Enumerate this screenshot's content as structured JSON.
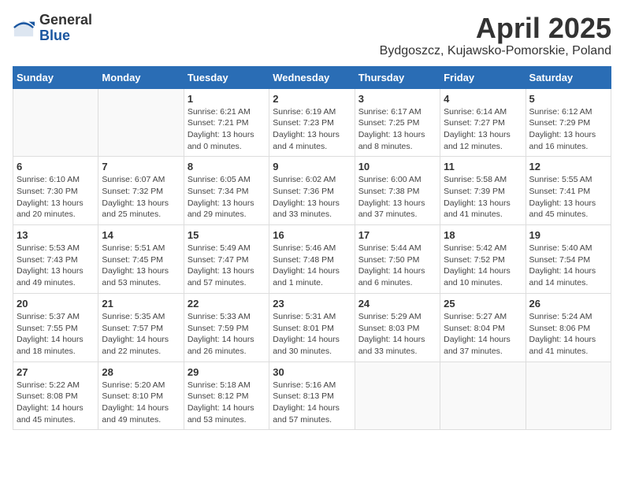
{
  "logo": {
    "general": "General",
    "blue": "Blue"
  },
  "title": "April 2025",
  "subtitle": "Bydgoszcz, Kujawsko-Pomorskie, Poland",
  "headers": [
    "Sunday",
    "Monday",
    "Tuesday",
    "Wednesday",
    "Thursday",
    "Friday",
    "Saturday"
  ],
  "weeks": [
    [
      {
        "day": "",
        "info": ""
      },
      {
        "day": "",
        "info": ""
      },
      {
        "day": "1",
        "info": "Sunrise: 6:21 AM\nSunset: 7:21 PM\nDaylight: 13 hours\nand 0 minutes."
      },
      {
        "day": "2",
        "info": "Sunrise: 6:19 AM\nSunset: 7:23 PM\nDaylight: 13 hours\nand 4 minutes."
      },
      {
        "day": "3",
        "info": "Sunrise: 6:17 AM\nSunset: 7:25 PM\nDaylight: 13 hours\nand 8 minutes."
      },
      {
        "day": "4",
        "info": "Sunrise: 6:14 AM\nSunset: 7:27 PM\nDaylight: 13 hours\nand 12 minutes."
      },
      {
        "day": "5",
        "info": "Sunrise: 6:12 AM\nSunset: 7:29 PM\nDaylight: 13 hours\nand 16 minutes."
      }
    ],
    [
      {
        "day": "6",
        "info": "Sunrise: 6:10 AM\nSunset: 7:30 PM\nDaylight: 13 hours\nand 20 minutes."
      },
      {
        "day": "7",
        "info": "Sunrise: 6:07 AM\nSunset: 7:32 PM\nDaylight: 13 hours\nand 25 minutes."
      },
      {
        "day": "8",
        "info": "Sunrise: 6:05 AM\nSunset: 7:34 PM\nDaylight: 13 hours\nand 29 minutes."
      },
      {
        "day": "9",
        "info": "Sunrise: 6:02 AM\nSunset: 7:36 PM\nDaylight: 13 hours\nand 33 minutes."
      },
      {
        "day": "10",
        "info": "Sunrise: 6:00 AM\nSunset: 7:38 PM\nDaylight: 13 hours\nand 37 minutes."
      },
      {
        "day": "11",
        "info": "Sunrise: 5:58 AM\nSunset: 7:39 PM\nDaylight: 13 hours\nand 41 minutes."
      },
      {
        "day": "12",
        "info": "Sunrise: 5:55 AM\nSunset: 7:41 PM\nDaylight: 13 hours\nand 45 minutes."
      }
    ],
    [
      {
        "day": "13",
        "info": "Sunrise: 5:53 AM\nSunset: 7:43 PM\nDaylight: 13 hours\nand 49 minutes."
      },
      {
        "day": "14",
        "info": "Sunrise: 5:51 AM\nSunset: 7:45 PM\nDaylight: 13 hours\nand 53 minutes."
      },
      {
        "day": "15",
        "info": "Sunrise: 5:49 AM\nSunset: 7:47 PM\nDaylight: 13 hours\nand 57 minutes."
      },
      {
        "day": "16",
        "info": "Sunrise: 5:46 AM\nSunset: 7:48 PM\nDaylight: 14 hours\nand 1 minute."
      },
      {
        "day": "17",
        "info": "Sunrise: 5:44 AM\nSunset: 7:50 PM\nDaylight: 14 hours\nand 6 minutes."
      },
      {
        "day": "18",
        "info": "Sunrise: 5:42 AM\nSunset: 7:52 PM\nDaylight: 14 hours\nand 10 minutes."
      },
      {
        "day": "19",
        "info": "Sunrise: 5:40 AM\nSunset: 7:54 PM\nDaylight: 14 hours\nand 14 minutes."
      }
    ],
    [
      {
        "day": "20",
        "info": "Sunrise: 5:37 AM\nSunset: 7:55 PM\nDaylight: 14 hours\nand 18 minutes."
      },
      {
        "day": "21",
        "info": "Sunrise: 5:35 AM\nSunset: 7:57 PM\nDaylight: 14 hours\nand 22 minutes."
      },
      {
        "day": "22",
        "info": "Sunrise: 5:33 AM\nSunset: 7:59 PM\nDaylight: 14 hours\nand 26 minutes."
      },
      {
        "day": "23",
        "info": "Sunrise: 5:31 AM\nSunset: 8:01 PM\nDaylight: 14 hours\nand 30 minutes."
      },
      {
        "day": "24",
        "info": "Sunrise: 5:29 AM\nSunset: 8:03 PM\nDaylight: 14 hours\nand 33 minutes."
      },
      {
        "day": "25",
        "info": "Sunrise: 5:27 AM\nSunset: 8:04 PM\nDaylight: 14 hours\nand 37 minutes."
      },
      {
        "day": "26",
        "info": "Sunrise: 5:24 AM\nSunset: 8:06 PM\nDaylight: 14 hours\nand 41 minutes."
      }
    ],
    [
      {
        "day": "27",
        "info": "Sunrise: 5:22 AM\nSunset: 8:08 PM\nDaylight: 14 hours\nand 45 minutes."
      },
      {
        "day": "28",
        "info": "Sunrise: 5:20 AM\nSunset: 8:10 PM\nDaylight: 14 hours\nand 49 minutes."
      },
      {
        "day": "29",
        "info": "Sunrise: 5:18 AM\nSunset: 8:12 PM\nDaylight: 14 hours\nand 53 minutes."
      },
      {
        "day": "30",
        "info": "Sunrise: 5:16 AM\nSunset: 8:13 PM\nDaylight: 14 hours\nand 57 minutes."
      },
      {
        "day": "",
        "info": ""
      },
      {
        "day": "",
        "info": ""
      },
      {
        "day": "",
        "info": ""
      }
    ]
  ]
}
